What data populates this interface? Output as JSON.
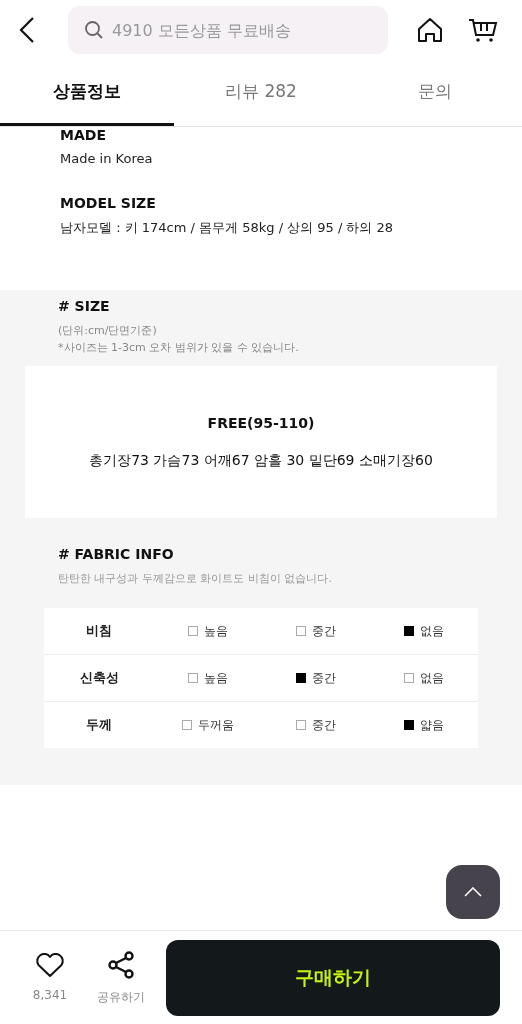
{
  "search": {
    "placeholder": "4910 모든상품 무료배송"
  },
  "tabs": [
    {
      "label": "상품정보",
      "selected": true
    },
    {
      "label": "리뷰 282",
      "selected": false
    },
    {
      "label": "문의",
      "selected": false
    }
  ],
  "made": {
    "heading": "MADE",
    "text": "Made in Korea"
  },
  "model_size": {
    "heading": "MODEL SIZE",
    "text": "남자모델 : 키 174cm / 몸무게 58kg / 상의 95  /  하의 28"
  },
  "size": {
    "heading": "# SIZE",
    "notes": [
      "(단위:cm/단면기준)",
      "*사이즈는 1-3cm 오차 범위가 있을 수 있습니다."
    ],
    "size_name": "FREE(95-110)",
    "measurements": "총기장73 가슴73 어깨67 암홀 30 밑단69 소매기장60"
  },
  "fabric": {
    "heading": "# FABRIC INFO",
    "note": "탄탄한 내구성과 두께감으로 화이트도 비침이 없습니다.",
    "rows": [
      {
        "label": "비침",
        "options": [
          {
            "label": "높음",
            "checked": false
          },
          {
            "label": "중간",
            "checked": false
          },
          {
            "label": "없음",
            "checked": true
          }
        ]
      },
      {
        "label": "신축성",
        "options": [
          {
            "label": "높음",
            "checked": false
          },
          {
            "label": "중간",
            "checked": true
          },
          {
            "label": "없음",
            "checked": false
          }
        ]
      },
      {
        "label": "두께",
        "options": [
          {
            "label": "두꺼움",
            "checked": false
          },
          {
            "label": "중간",
            "checked": false
          },
          {
            "label": "얇음",
            "checked": true
          }
        ]
      }
    ]
  },
  "bottom_bar": {
    "likes": "8,341",
    "share": "공유하기",
    "buy": "구매하기"
  }
}
